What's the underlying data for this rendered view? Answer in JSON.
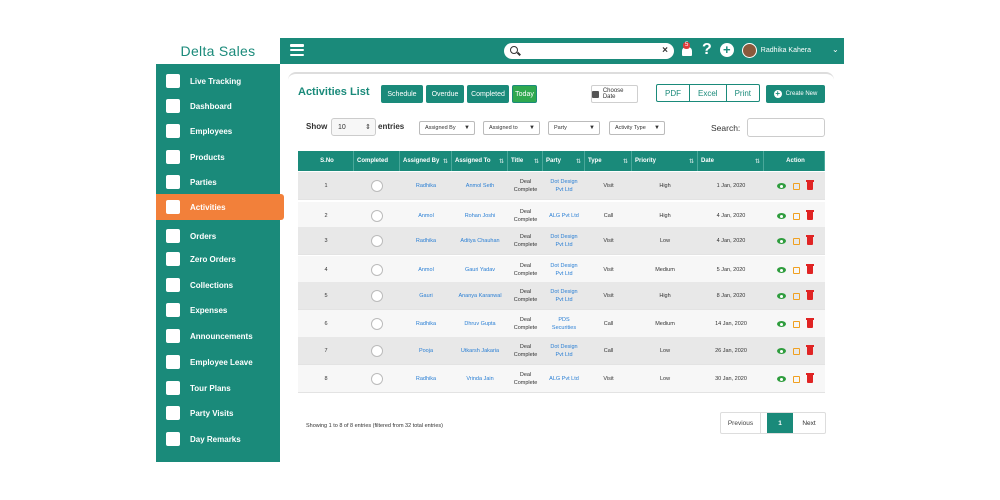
{
  "brand": "Delta Sales",
  "sidebar": {
    "items": [
      {
        "label": "Live Tracking",
        "icon": "location-pin-icon"
      },
      {
        "label": "Dashboard",
        "icon": "gauge-icon"
      },
      {
        "label": "Employees",
        "icon": "user-icon"
      },
      {
        "label": "Products",
        "icon": "grid-icon"
      },
      {
        "label": "Parties",
        "icon": "store-icon"
      },
      {
        "label": "Activities",
        "icon": "document-icon",
        "active": true
      },
      {
        "label": "Orders",
        "icon": "cart-icon"
      },
      {
        "label": "Zero Orders",
        "icon": "cart-icon"
      },
      {
        "label": "Collections",
        "icon": "money-icon"
      },
      {
        "label": "Expenses",
        "icon": "expense-icon"
      },
      {
        "label": "Announcements",
        "icon": "megaphone-icon"
      },
      {
        "label": "Employee Leave",
        "icon": "tag-icon"
      },
      {
        "label": "Tour Plans",
        "icon": "plane-icon"
      },
      {
        "label": "Party Visits",
        "icon": "handshake-icon"
      },
      {
        "label": "Day Remarks",
        "icon": "notepad-icon"
      }
    ]
  },
  "topbar": {
    "search_value": "",
    "clear": "×",
    "notification_count": "5",
    "help": "?",
    "add": "+",
    "username": "Radhika Kahera",
    "caret": "⌄"
  },
  "page": {
    "title": "Activities List",
    "filters_buttons": [
      "Schedule",
      "Overdue",
      "Completed",
      "Today"
    ],
    "choose_date": "Choose Date",
    "export": [
      "PDF",
      "Excel",
      "Print"
    ],
    "create_new": "Create New",
    "show": "Show",
    "show_value": "10",
    "entries": "entries",
    "filter_selects": [
      "Assigned By",
      "Assigned to",
      "Party",
      "Activity Type"
    ],
    "search_label": "Search:"
  },
  "table": {
    "columns": [
      "S.No",
      "Completed",
      "Assigned By",
      "Assigned To",
      "Title",
      "Party",
      "Type",
      "Priority",
      "Date",
      "Action"
    ],
    "rows": [
      {
        "sno": "1",
        "by": "Radhika",
        "to": "Anmol Seth",
        "title": "Deal Complete",
        "party": "Dot Design Pvt Ltd",
        "type": "Visit",
        "priority": "High",
        "date": "1 Jan, 2020"
      },
      {
        "sno": "2",
        "by": "Anmol",
        "to": "Rohan Joshi",
        "title": "Deal Complete",
        "party": "ALG Pvt Ltd",
        "type": "Call",
        "priority": "High",
        "date": "4 Jan, 2020"
      },
      {
        "sno": "3",
        "by": "Radhika",
        "to": "Aditya Chauhan",
        "title": "Deal Complete",
        "party": "Dot Design Pvt Ltd",
        "type": "Visit",
        "priority": "Low",
        "date": "4 Jan, 2020"
      },
      {
        "sno": "4",
        "by": "Anmol",
        "to": "Gauri Yadav",
        "title": "Deal Complete",
        "party": "Dot Design Pvt Ltd",
        "type": "Visit",
        "priority": "Medium",
        "date": "5 Jan, 2020"
      },
      {
        "sno": "5",
        "by": "Gauri",
        "to": "Ananya Karanwal",
        "title": "Deal Complete",
        "party": "Dot Design Pvt Ltd",
        "type": "Visit",
        "priority": "High",
        "date": "8 Jan, 2020"
      },
      {
        "sno": "6",
        "by": "Radhika",
        "to": "Dhruv Gupta",
        "title": "Deal Complete",
        "party": "PDS Securities",
        "type": "Call",
        "priority": "Medium",
        "date": "14 Jan, 2020"
      },
      {
        "sno": "7",
        "by": "Pooja",
        "to": "Utkarsh Jakaria",
        "title": "Deal Complete",
        "party": "Dot Design Pvt Ltd",
        "type": "Call",
        "priority": "Low",
        "date": "26 Jan, 2020"
      },
      {
        "sno": "8",
        "by": "Radhika",
        "to": "Vrinda Jain",
        "title": "Deal Complete",
        "party": "ALG Pvt Ltd",
        "type": "Visit",
        "priority": "Low",
        "date": "30 Jan, 2020"
      }
    ]
  },
  "footer": {
    "info": "Showing 1 to 8 of 8 entries (filtered from 32 total entries)",
    "previous": "Previous",
    "page": "1",
    "next": "Next"
  },
  "colors": {
    "primary": "#1a8a7a",
    "accent": "#f2803a",
    "link": "#2a7fd4",
    "today": "#2fa84f"
  }
}
